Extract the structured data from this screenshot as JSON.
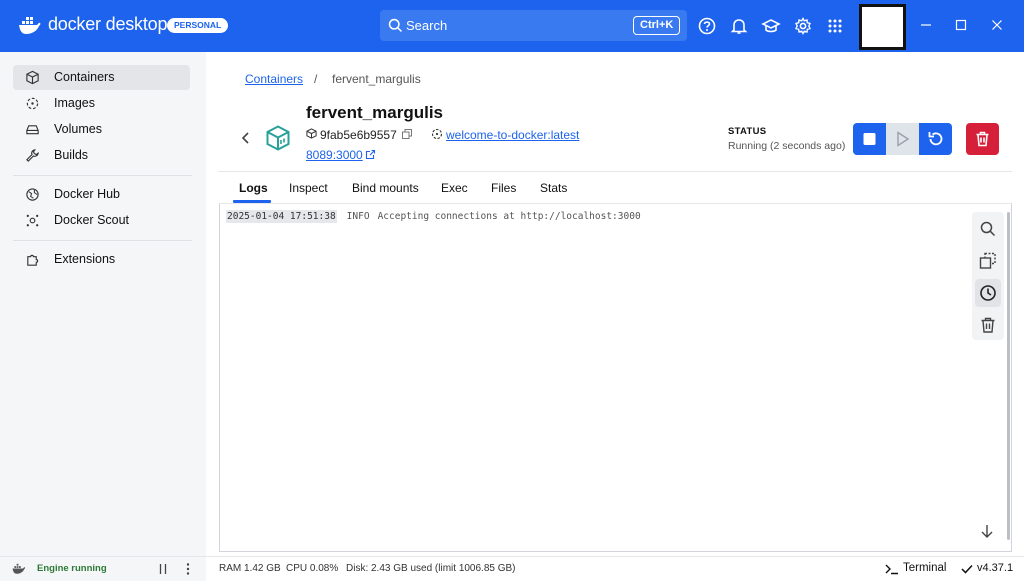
{
  "app": {
    "logo_text": "docker desktop",
    "plan_badge": "PERSONAL"
  },
  "search": {
    "placeholder": "Search",
    "shortcut": "Ctrl+K"
  },
  "sidebar": {
    "items": [
      {
        "label": "Containers",
        "icon": "cube-icon",
        "active": true
      },
      {
        "label": "Images",
        "icon": "images-icon"
      },
      {
        "label": "Volumes",
        "icon": "volume-icon"
      },
      {
        "label": "Builds",
        "icon": "wrench-icon"
      },
      {
        "label": "Docker Hub",
        "icon": "globe-icon"
      },
      {
        "label": "Docker Scout",
        "icon": "scout-icon"
      },
      {
        "label": "Extensions",
        "icon": "puzzle-icon"
      }
    ]
  },
  "breadcrumb": {
    "parent": "Containers",
    "separator": "/",
    "current": "fervent_margulis"
  },
  "container": {
    "name": "fervent_margulis",
    "id": "9fab5e6b9557",
    "image": "welcome-to-docker:latest",
    "ports": "8089:3000",
    "status_label": "STATUS",
    "status_value": "Running (2 seconds ago)"
  },
  "tabs": [
    "Logs",
    "Inspect",
    "Bind mounts",
    "Exec",
    "Files",
    "Stats"
  ],
  "logs": [
    {
      "timestamp": "2025-01-04 17:51:38",
      "level": "INFO",
      "message": "Accepting connections at http://localhost:3000"
    }
  ],
  "footer": {
    "engine": "Engine running",
    "ram": "RAM 1.42 GB",
    "cpu": "CPU 0.08%",
    "disk": "Disk: 2.43 GB used (limit 1006.85 GB)",
    "terminal": "Terminal",
    "version": "v4.37.1"
  },
  "colors": {
    "brand": "#1d63ed",
    "danger": "#d61f39",
    "container_icon": "#2aa198",
    "engine_ok": "#2d7a36"
  }
}
